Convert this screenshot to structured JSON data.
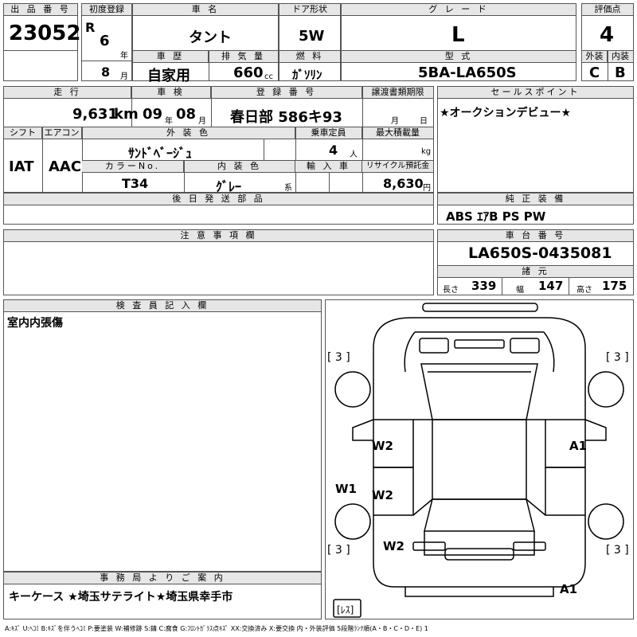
{
  "header": {
    "lot_label": "出 品 番 号",
    "lot_number": "23052",
    "first_reg_label": "初度登録",
    "era": "R",
    "reg_year": "6",
    "year_unit": "年",
    "reg_month": "8",
    "month_unit": "月",
    "car_name_label": "車 名",
    "car_name": "タント",
    "door_label": "ドア形状",
    "door": "5W",
    "grade_label": "グ レ ー ド",
    "grade": "L",
    "score_label": "評価点",
    "score": "4",
    "history_label": "車 歴",
    "history": "自家用",
    "displacement_label": "排 気 量",
    "displacement": "660",
    "displacement_unit": "cc",
    "fuel_label": "燃 料",
    "fuel": "ｶﾞｿﾘﾝ",
    "model_label": "型 式",
    "model": "5BA-LA650S",
    "exterior_label": "外装",
    "exterior": "C",
    "interior_label": "内装",
    "interior": "B"
  },
  "info": {
    "mileage_label": "走 行",
    "mileage": "9,631",
    "mileage_unit": "km",
    "inspection_label": "車 検",
    "insp_year": "09",
    "insp_year_unit": "年",
    "insp_month": "08",
    "insp_month_unit": "月",
    "plate_label": "登 録 番 号",
    "plate": "春日部 586キ93",
    "transfer_label": "譲渡書類期限",
    "transfer_month": "月",
    "transfer_day": "日",
    "shift_label": "シフト",
    "shift": "IAT",
    "ac_label": "エアコン",
    "ac": "AAC",
    "ext_color_label": "外 装 色",
    "ext_color": "ｻﾝﾄﾞﾍﾞｰｼﾞｭ",
    "capacity_label": "乗車定員",
    "capacity": "4",
    "capacity_unit": "人",
    "load_label": "最大積載量",
    "load_unit": "kg",
    "color_no_label": "カラーNo.",
    "color_no": "T34",
    "int_color_label": "内 装 色",
    "int_color": "ｸﾞﾚｰ",
    "int_color_unit": "系",
    "import_label": "輸 入 車",
    "recycle_label": "リサイクル預託金",
    "recycle": "8,630",
    "recycle_unit": "円",
    "later_parts_label": "後 日 発 送 部 品",
    "notes_label": "注 意 事 項 欄"
  },
  "right": {
    "selling_label": "セールスポイント",
    "selling": "★オークションデビュー★",
    "equipment_label": "純 正 装 備",
    "equipment": "ABS ｴｱB PS PW",
    "chassis_label": "車 台 番 号",
    "chassis": "LA650S-0435081",
    "spec_label": "諸 元",
    "length_label": "長さ",
    "length": "339",
    "width_label": "幅",
    "width": "147",
    "height_label": "高さ",
    "height": "175"
  },
  "inspector": {
    "label": "検 査 員 記 入 欄",
    "note": "室内内張傷"
  },
  "office": {
    "label": "事 務 局 よ り ご 案 内",
    "note": "キーケース ★埼玉サテライト★埼玉県幸手市"
  },
  "diagram": {
    "rank_fl": "[ 3 ]",
    "rank_fr": "[ 3 ]",
    "rank_rl": "[ 3 ]",
    "rank_rr": "[ 3 ]",
    "spare": "[ﾚｽ]",
    "marks": {
      "w2_a": "W2",
      "w2_b": "W2",
      "w2_c": "W2",
      "w1": "W1",
      "a1_a": "A1",
      "a1_b": "A1"
    }
  },
  "legend": "A:ｷｽﾞ U:ﾍｺﾐ B:ｷｽﾞを伴うﾍｺﾐ P:要塗装 W:補修跡 S:錆 C:腐食 G:ﾌﾛﾝﾄｶﾞﾗｽ点ｷｽﾞ XX:交換済み X:要交換 内・外装評価 5段階ﾗﾝｸ順(A・B・C・D・E) 1"
}
